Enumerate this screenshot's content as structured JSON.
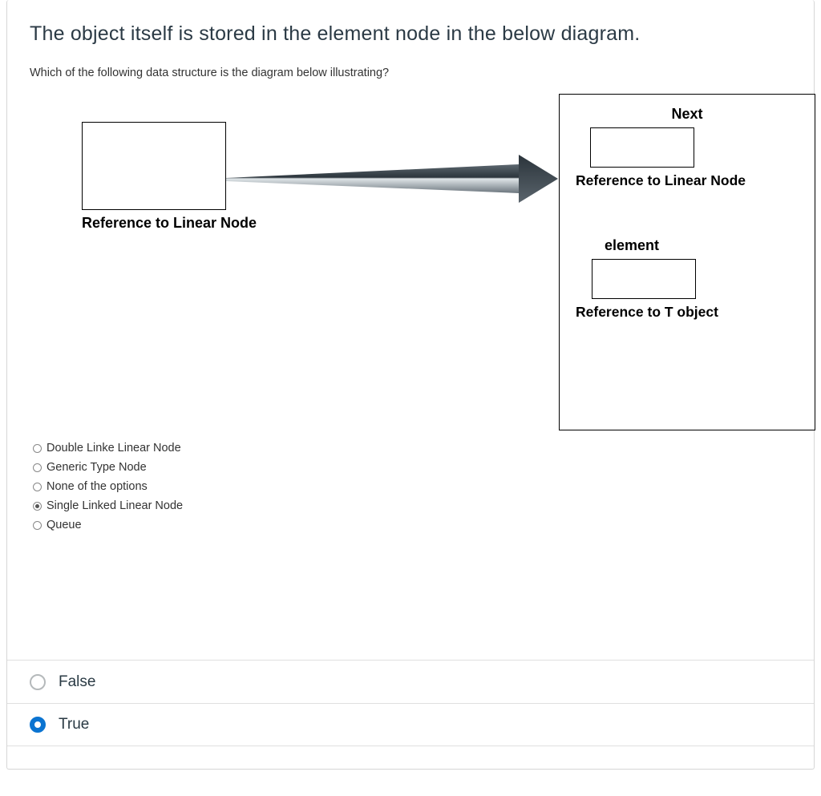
{
  "question": {
    "title": "The object itself is stored in the element node in the below diagram.",
    "sub_prompt": "Which of the following data structure is the diagram below illustrating?"
  },
  "diagram": {
    "left_caption": "Reference to Linear Node",
    "right_panel": {
      "next_label": "Next",
      "next_caption": "Reference to Linear Node",
      "element_label": "element",
      "element_caption": "Reference to T object"
    }
  },
  "mc_options": [
    {
      "label": "Double Linke Linear Node",
      "selected": false
    },
    {
      "label": "Generic Type Node",
      "selected": false
    },
    {
      "label": "None of the options",
      "selected": false
    },
    {
      "label": "Single Linked Linear Node",
      "selected": true
    },
    {
      "label": "Queue",
      "selected": false
    }
  ],
  "tf_options": [
    {
      "label": "False",
      "selected": false
    },
    {
      "label": "True",
      "selected": true
    }
  ]
}
